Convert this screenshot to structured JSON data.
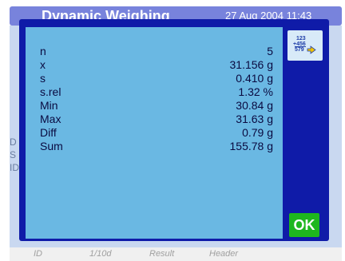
{
  "background": {
    "title": "Dynamic Weighing",
    "date": "27 Aug 2004 11:43",
    "side_labels": [
      "D",
      "S",
      "ID"
    ],
    "nav": [
      "ID",
      "1/10d",
      "Result",
      "Header"
    ]
  },
  "dialog": {
    "rows": [
      {
        "label": "n",
        "value": "5"
      },
      {
        "label": "x",
        "value": "31.156 g"
      },
      {
        "label": "s",
        "value": "0.410 g"
      },
      {
        "label": "s.rel",
        "value": "1.32 %"
      },
      {
        "label": "Min",
        "value": "30.84 g"
      },
      {
        "label": "Max",
        "value": "31.63 g"
      },
      {
        "label": "Diff",
        "value": "0.79 g"
      },
      {
        "label": "Sum",
        "value": "155.78 g"
      }
    ],
    "print_icon": "print-list-icon",
    "ok_label": "OK"
  },
  "colors": {
    "dialog_border": "#0f1ba8",
    "panel": "#6ab8e3",
    "ok": "#1eb71e"
  }
}
